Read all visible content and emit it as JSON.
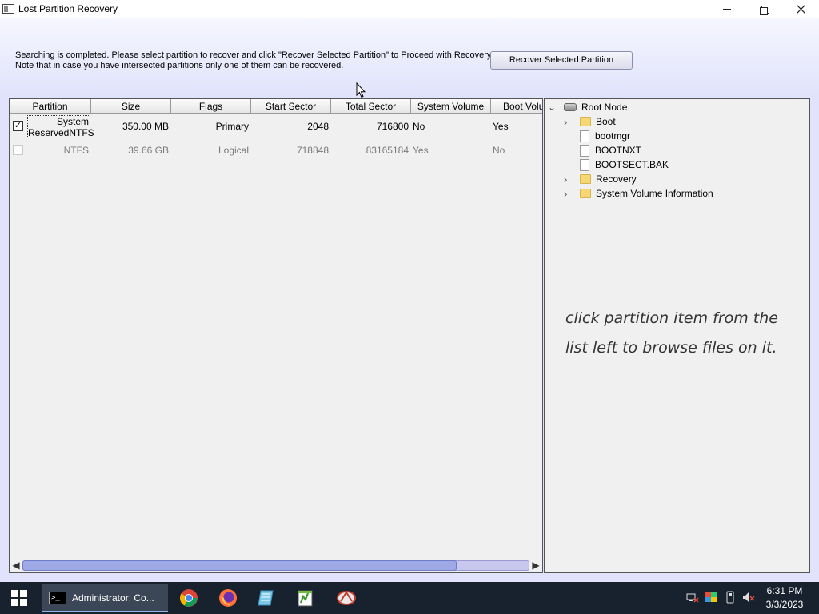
{
  "window": {
    "title": "Lost Partition Recovery"
  },
  "info": {
    "line1": "Searching is completed. Please select partition to recover and click \"Recover Selected Partition\" to Proceed with Recovery.",
    "line2": "Note that in case you have intersected partitions only one of them can be recovered."
  },
  "recover_button": "Recover Selected Partition",
  "list": {
    "columns": [
      "Partition",
      "Size",
      "Flags",
      "Start Sector",
      "Total Sector",
      "System Volume",
      "Boot Volu"
    ],
    "rows": [
      {
        "checked": true,
        "check_mark": "✓",
        "partition_line1": "System",
        "partition_line2": "ReservedNTFS",
        "size": "350.00 MB",
        "flags": "Primary",
        "start_sector": "2048",
        "total_sector": "716800",
        "system_volume": "No",
        "boot_volume": "Yes"
      },
      {
        "checked": false,
        "partition": "NTFS",
        "size": "39.66 GB",
        "flags": "Logical",
        "start_sector": "718848",
        "total_sector": "83165184",
        "system_volume": "Yes",
        "boot_volume": "No"
      }
    ],
    "scroll_left": "◀",
    "scroll_right": "▶"
  },
  "tree": {
    "root": "Root Node",
    "root_expander": "⌄",
    "items": [
      {
        "label": "Boot",
        "type": "folder",
        "expander": "›"
      },
      {
        "label": "bootmgr",
        "type": "file"
      },
      {
        "label": "BOOTNXT",
        "type": "file"
      },
      {
        "label": "BOOTSECT.BAK",
        "type": "file"
      },
      {
        "label": "Recovery",
        "type": "folder",
        "expander": "›"
      },
      {
        "label": "System Volume Information",
        "type": "folder",
        "expander": "›"
      }
    ],
    "hint": "click partition item from the list left to browse files on it."
  },
  "taskbar": {
    "active_task": "Administrator: Co...",
    "cmd_glyph": ">_",
    "pinned": [
      "chrome-icon",
      "firefox-icon",
      "notepad-icon",
      "notepad-plus-icon",
      "recovery-app-icon"
    ],
    "clock_time": "6:31 PM",
    "clock_date": "3/3/2023"
  },
  "colors": {
    "taskbar": "#18222f",
    "panel_bg": "#f0f0f0",
    "scroll_thumb": "#9ea9e6",
    "folder": "#f7d774"
  }
}
